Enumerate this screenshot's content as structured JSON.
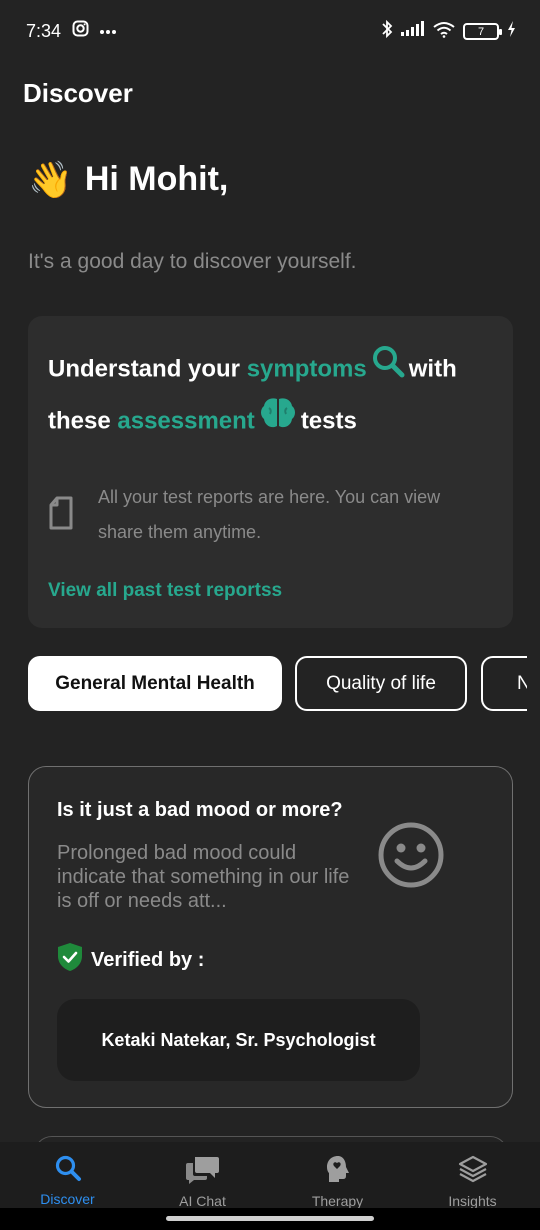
{
  "status_bar": {
    "time": "7:34",
    "battery_level": "7",
    "icons": [
      "instagram-icon",
      "more-icon",
      "bluetooth-icon",
      "signal-icon",
      "wifi-icon",
      "battery-icon",
      "charging-icon"
    ]
  },
  "header": {
    "title": "Discover"
  },
  "greeting": {
    "emoji": "👋",
    "text": "Hi Mohit,",
    "subtitle": "It's a good day to discover yourself."
  },
  "assessment_card": {
    "heading_part1": "Understand your",
    "heading_accent1": "symptoms",
    "heading_part2": "with",
    "heading_part3": "these",
    "heading_accent2": "assessment",
    "heading_part4": "tests",
    "reports_text": "All your test reports are here. You can view share them anytime.",
    "reports_link": "View all past test reportss"
  },
  "categories": [
    {
      "label": "General Mental Health",
      "active": true
    },
    {
      "label": "Quality of life",
      "active": false
    },
    {
      "label": "Ne",
      "active": false
    }
  ],
  "test_card": {
    "title": "Is it just a bad mood or more?",
    "description": "Prolonged bad mood could indicate that something in our life is off or needs att...",
    "verified_label": "Verified by :",
    "verifier": "Ketaki Natekar, Sr. Psychologist"
  },
  "bottom_nav": [
    {
      "label": "Discover",
      "icon": "search-icon",
      "active": true
    },
    {
      "label": "AI Chat",
      "icon": "chat-icon",
      "active": false
    },
    {
      "label": "Therapy",
      "icon": "therapy-head-icon",
      "active": false
    },
    {
      "label": "Insights",
      "icon": "layers-icon",
      "active": false
    }
  ],
  "colors": {
    "background": "#232323",
    "accent": "#27a88e",
    "nav_active": "#2e8ff0",
    "card": "#2d2d2d"
  }
}
